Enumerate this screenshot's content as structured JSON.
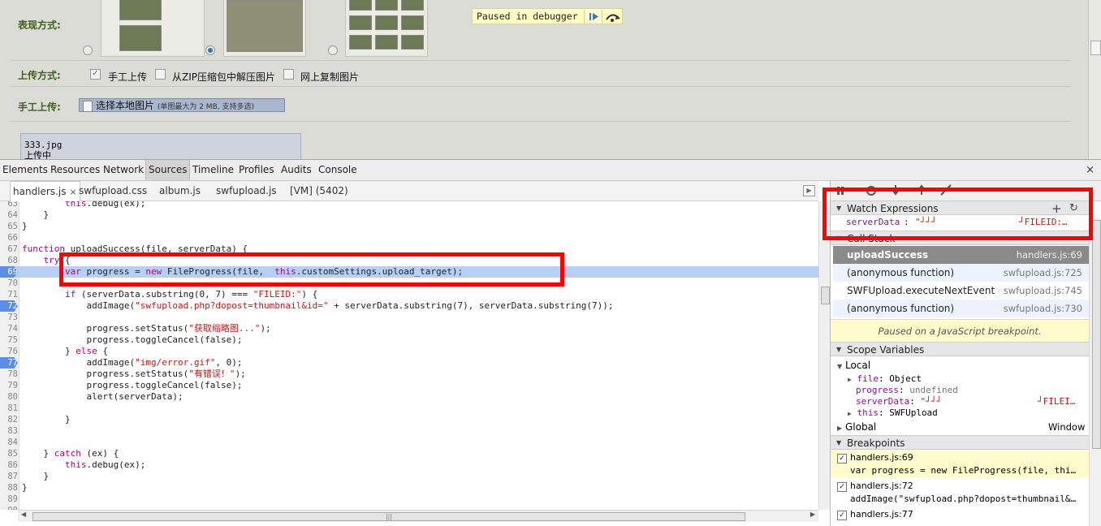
{
  "page": {
    "display_mode_label": "表现方式:",
    "upload_mode_label": "上传方式:",
    "manual_upload_label": "手工上传:",
    "upload_options": [
      {
        "label": "手工上传",
        "checked": true
      },
      {
        "label": "从ZIP压缩包中解压图片",
        "checked": false
      },
      {
        "label": "网上复制图片",
        "checked": false
      }
    ],
    "select_button_label": "选择本地图片",
    "select_button_hint": "(单图最大为 2 MB, 支持多选)",
    "upload_file_name": "333.jpg",
    "upload_file_status": "上传中",
    "paused_banner": "Paused in debugger"
  },
  "devtools": {
    "main_tabs": [
      "Elements",
      "Resources",
      "Network",
      "Sources",
      "Timeline",
      "Profiles",
      "Audits",
      "Console"
    ],
    "selected_main_tab": "Sources",
    "close_glyph": "×",
    "file_tabs": [
      "handlers.js",
      "swfupload.css",
      "album.js",
      "swfupload.js",
      "[VM] (5402)"
    ],
    "selected_file_tab": "handlers.js",
    "file_tab_close": "×",
    "code_lines": [
      {
        "n": "63",
        "text": "        this.debug(ex);"
      },
      {
        "n": "64",
        "text": "    }"
      },
      {
        "n": "65",
        "text": "}"
      },
      {
        "n": "66",
        "text": ""
      },
      {
        "n": "67",
        "text": "function uploadSuccess(file, serverData) {"
      },
      {
        "n": "68",
        "text": "    try {"
      },
      {
        "n": "69",
        "text": "        var progress = new FileProgress(file,  this.customSettings.upload_target);",
        "bp": true,
        "exec": true
      },
      {
        "n": "70",
        "text": ""
      },
      {
        "n": "71",
        "text": "        if (serverData.substring(0, 7) === \"FILEID:\") {"
      },
      {
        "n": "72",
        "text": "            addImage(\"swfupload.php?dopost=thumbnail&id=\" + serverData.substring(7), serverData.substring(7));",
        "bp": true
      },
      {
        "n": "73",
        "text": ""
      },
      {
        "n": "74",
        "text": "            progress.setStatus(\"获取缩略图...\");"
      },
      {
        "n": "75",
        "text": "            progress.toggleCancel(false);"
      },
      {
        "n": "76",
        "text": "        } else {"
      },
      {
        "n": "77",
        "text": "            addImage(\"img/error.gif\", 0);",
        "bp": true
      },
      {
        "n": "78",
        "text": "            progress.setStatus(\"有错误！\");"
      },
      {
        "n": "79",
        "text": "            progress.toggleCancel(false);"
      },
      {
        "n": "80",
        "text": "            alert(serverData);"
      },
      {
        "n": "81",
        "text": ""
      },
      {
        "n": "82",
        "text": "        }"
      },
      {
        "n": "83",
        "text": ""
      },
      {
        "n": "84",
        "text": ""
      },
      {
        "n": "85",
        "text": "    } catch (ex) {"
      },
      {
        "n": "86",
        "text": "        this.debug(ex);"
      },
      {
        "n": "87",
        "text": "    }"
      },
      {
        "n": "88",
        "text": "}"
      },
      {
        "n": "89",
        "text": ""
      },
      {
        "n": "90",
        "text": ""
      }
    ],
    "sidebar": {
      "watch_header": "Watch Expressions",
      "watch_add": "+",
      "watch_refresh": "↻",
      "watch_items": [
        {
          "name": "serverData",
          "value": "\"┘┘┘",
          "value_tail": "┘FILEID:…"
        }
      ],
      "call_stack_header": "Call Stack",
      "call_stack": [
        {
          "fn": "uploadSuccess",
          "loc": "handlers.js:69"
        },
        {
          "fn": "(anonymous function)",
          "loc": "swfupload.js:725"
        },
        {
          "fn": "SWFUpload.executeNextEvent",
          "loc": "swfupload.js:745"
        },
        {
          "fn": "(anonymous function)",
          "loc": "swfupload.js:730"
        }
      ],
      "paused_message": "Paused on a JavaScript breakpoint.",
      "scope_header": "Scope Variables",
      "scope_local": "Local",
      "scope_vars": [
        {
          "name": "file",
          "value": "Object"
        },
        {
          "name": "progress",
          "value": "undefined"
        },
        {
          "name": "serverData",
          "value": "\"┘┘┘",
          "value_tail": "┘FILEI…"
        },
        {
          "name": "this",
          "value": "SWFUpload"
        }
      ],
      "scope_global": "Global",
      "scope_global_value": "Window",
      "breakpoints_header": "Breakpoints",
      "breakpoints": [
        {
          "loc": "handlers.js:69",
          "code": "var progress = new FileProgress(file, thi…"
        },
        {
          "loc": "handlers.js:72",
          "code": "addImage(\"swfupload.php?dopost=thumbnail&…"
        },
        {
          "loc": "handlers.js:77",
          "code": ""
        }
      ],
      "check_glyph": "✓"
    }
  },
  "colors": {
    "highlight_box": "#ff0000",
    "exec_line": "#b7cff3",
    "breakpoint": "#5b8ee6"
  }
}
